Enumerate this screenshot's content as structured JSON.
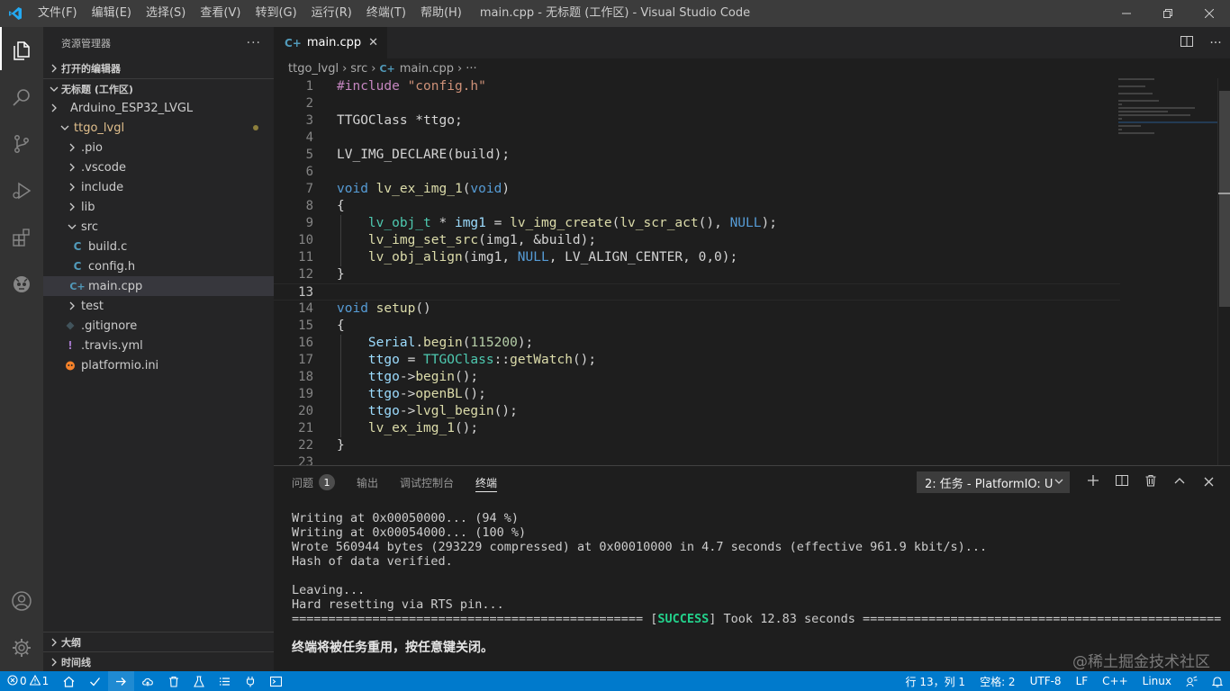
{
  "window": {
    "title": "main.cpp - 无标题 (工作区) - Visual Studio Code",
    "menus": [
      "文件(F)",
      "编辑(E)",
      "选择(S)",
      "查看(V)",
      "转到(G)",
      "运行(R)",
      "终端(T)",
      "帮助(H)"
    ]
  },
  "sidebar": {
    "title": "资源管理器",
    "open_editors": "打开的编辑器",
    "workspace": "无标题 (工作区)",
    "tree": [
      {
        "label": "Arduino_ESP32_LVGL",
        "type": "folder"
      },
      {
        "label": "ttgo_lvgl",
        "type": "folder-open",
        "modified": true
      },
      {
        "label": ".pio",
        "type": "folder"
      },
      {
        "label": ".vscode",
        "type": "folder"
      },
      {
        "label": "include",
        "type": "folder"
      },
      {
        "label": "lib",
        "type": "folder"
      },
      {
        "label": "src",
        "type": "folder-open"
      },
      {
        "label": "build.c",
        "type": "c-file"
      },
      {
        "label": "config.h",
        "type": "c-file"
      },
      {
        "label": "main.cpp",
        "type": "cpp-file",
        "selected": true
      },
      {
        "label": "test",
        "type": "folder"
      },
      {
        "label": ".gitignore",
        "type": "git-file"
      },
      {
        "label": ".travis.yml",
        "type": "yaml-file"
      },
      {
        "label": "platformio.ini",
        "type": "pio-file"
      }
    ],
    "outline": "大纲",
    "timeline": "时间线"
  },
  "editor": {
    "tab": "main.cpp",
    "breadcrumb": [
      "ttgo_lvgl",
      "src",
      "main.cpp",
      "···"
    ],
    "line_numbers": [
      "1",
      "2",
      "3",
      "4",
      "5",
      "6",
      "7",
      "8",
      "9",
      "10",
      "11",
      "12",
      "13",
      "14",
      "15",
      "16",
      "17",
      "18",
      "19",
      "20",
      "21",
      "22",
      "23"
    ],
    "current_line": 13
  },
  "panel": {
    "tabs": [
      "问题",
      "输出",
      "调试控制台",
      "终端"
    ],
    "problems_count": "1",
    "active_tab": "终端",
    "terminal_select": "2: 任务 - PlatformIO: U",
    "terminal_lines": [
      "Writing at 0x00050000... (94 %)",
      "Writing at 0x00054000... (100 %)",
      "Wrote 560944 bytes (293229 compressed) at 0x00010000 in 4.7 seconds (effective 961.9 kbit/s)...",
      "Hash of data verified.",
      "",
      "Leaving...",
      "Hard resetting via RTS pin..."
    ],
    "success_line": {
      "left": "================================================ [",
      "status": "SUCCESS",
      "right": "] Took 12.83 seconds ================================================="
    },
    "final_message": "终端将被任务重用，按任意键关闭。",
    "watermark": "@稀土掘金技术社区"
  },
  "statusbar": {
    "errors": "0",
    "warnings": "1",
    "position": "行 13，列 1",
    "spaces": "空格: 2",
    "encoding": "UTF-8",
    "eol": "LF",
    "language": "C++",
    "platform": "Linux"
  },
  "colors": {
    "accent": "#007acc",
    "success": "#23d18b",
    "modified": "#e2c08d"
  }
}
